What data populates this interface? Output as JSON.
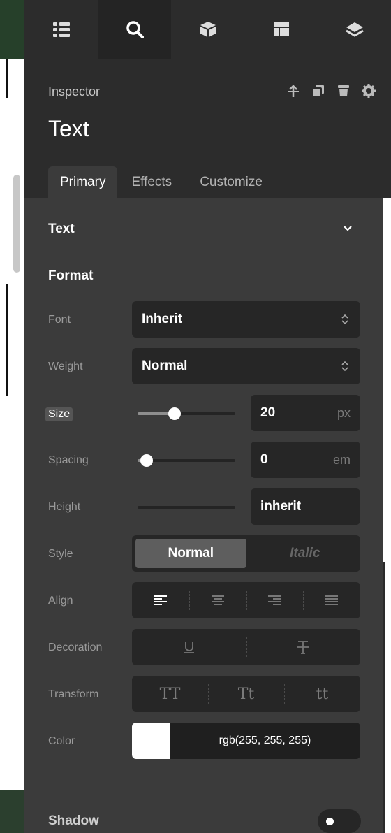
{
  "colors": {
    "panel": "#3b3b3b",
    "header": "#2c2c2c",
    "field": "#262626",
    "text": "#ffffff",
    "muted": "#9a9a9a"
  },
  "topnav": {
    "icons": [
      "list-icon",
      "search-icon",
      "cube-icon",
      "layout-icon",
      "layers-icon"
    ],
    "active": "search-icon"
  },
  "header": {
    "label": "Inspector",
    "title": "Text",
    "actions": [
      "move-up-icon",
      "duplicate-icon",
      "delete-icon",
      "settings-icon"
    ]
  },
  "tabs": [
    {
      "label": "Primary",
      "active": true
    },
    {
      "label": "Effects"
    },
    {
      "label": "Customize"
    }
  ],
  "sections": {
    "text": "Text",
    "format": "Format",
    "shadow": "Shadow"
  },
  "rows": {
    "font": {
      "label": "Font",
      "value": "Inherit"
    },
    "weight": {
      "label": "Weight",
      "value": "Normal"
    },
    "size": {
      "label": "Size",
      "value": "20",
      "unit": "px",
      "slider": 0.38
    },
    "spacing": {
      "label": "Spacing",
      "value": "0",
      "unit": "em",
      "slider": 0.09
    },
    "height": {
      "label": "Height",
      "value": "inherit"
    },
    "style": {
      "label": "Style",
      "options": [
        "Normal",
        "Italic"
      ],
      "selected": "Normal"
    },
    "align": {
      "label": "Align",
      "options": [
        "align-left-icon",
        "align-center-icon",
        "align-right-icon",
        "align-justify-icon"
      ],
      "selected": "align-left-icon"
    },
    "decoration": {
      "label": "Decoration",
      "options": [
        "underline-icon",
        "strikethrough-icon"
      ]
    },
    "transform": {
      "label": "Transform",
      "options": [
        "TT",
        "Tt",
        "tt"
      ]
    },
    "color": {
      "label": "Color",
      "value": "rgb(255, 255, 255)",
      "swatch": "#ffffff"
    }
  },
  "shadow_toggle": false
}
